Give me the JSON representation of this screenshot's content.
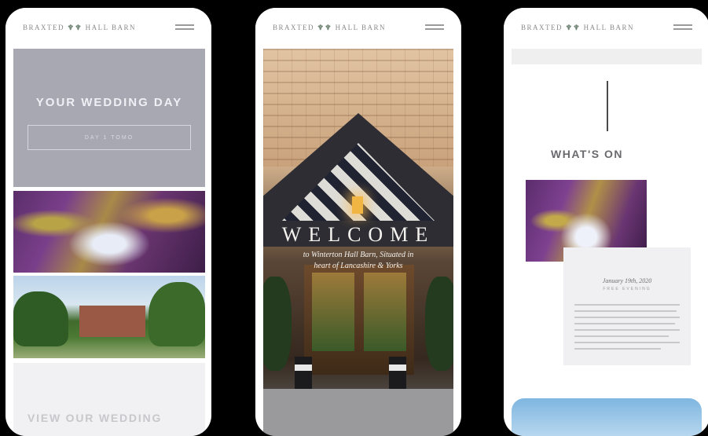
{
  "phones": [
    {
      "header": {
        "logo_text": "BRAXTED",
        "logo_mark": "♆♆",
        "logo_text2": "HALL BARN"
      },
      "hero": {
        "title": "YOUR WEDDING DAY",
        "button_label": "DAY 1 TOMO"
      },
      "images": [
        "barn-interior-purple-lights",
        "red-brick-manor-house"
      ],
      "bottom_heading": "VIEW OUR WEDDING"
    },
    {
      "header": {
        "logo_text": "BRAXTED",
        "logo_mark": "♆♆",
        "logo_text2": "HALL BARN"
      },
      "welcome": {
        "title": "WELCOME",
        "subtitle_line1": "to Winterton Hall Barn, Situated in",
        "subtitle_line2": "heart of Lancashire & Yorks"
      }
    },
    {
      "header": {
        "logo_text": "BRAXTED",
        "logo_mark": "♆♆",
        "logo_text2": "HALL BARN"
      },
      "section_title": "WHAT'S ON",
      "event": {
        "date": "January 19th, 2020",
        "tag": "FREE EVENING"
      }
    }
  ],
  "icons": {
    "menu": "hamburger-menu-icon"
  },
  "colors": {
    "background": "#000000",
    "hero_grey": "#a7a8b1",
    "light_panel": "#f0f0f2",
    "accent_green": "#6a7f6e"
  }
}
